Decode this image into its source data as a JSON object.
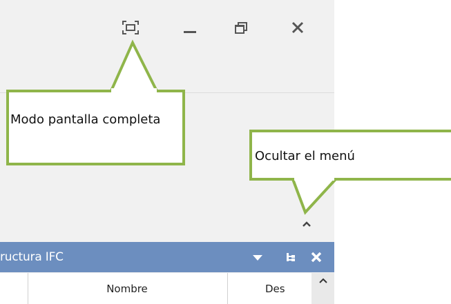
{
  "window_controls": {
    "fullscreen_icon": "fullscreen-icon",
    "minimize_icon": "minimize-icon",
    "restore_icon": "restore-icon",
    "close_icon": "close-icon"
  },
  "menu": {
    "collapse_icon": "chevron-up-icon"
  },
  "callouts": {
    "fullscreen": "Modo pantalla completa",
    "hide_menu": "Ocultar el menú",
    "color": "#8fb54a"
  },
  "panel": {
    "title": "ructura IFC",
    "header_color": "#6c8ebf",
    "icons": [
      "dropdown-icon",
      "tree-icon",
      "close-icon"
    ]
  },
  "table": {
    "columns": [
      "Nombre",
      "Des"
    ]
  }
}
